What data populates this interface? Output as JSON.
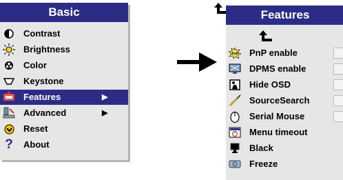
{
  "basic_menu": {
    "title": "Basic",
    "items": [
      {
        "label": "Contrast",
        "icon": "contrast-icon",
        "has_submenu": false,
        "selected": false
      },
      {
        "label": "Brightness",
        "icon": "brightness-icon",
        "has_submenu": false,
        "selected": false
      },
      {
        "label": "Color",
        "icon": "color-icon",
        "has_submenu": false,
        "selected": false
      },
      {
        "label": "Keystone",
        "icon": "keystone-icon",
        "has_submenu": false,
        "selected": false
      },
      {
        "label": "Features",
        "icon": "features-icon",
        "has_submenu": true,
        "selected": true
      },
      {
        "label": "Advanced",
        "icon": "advanced-icon",
        "has_submenu": true,
        "selected": false
      },
      {
        "label": "Reset",
        "icon": "reset-icon",
        "has_submenu": false,
        "selected": false
      },
      {
        "label": "About",
        "icon": "about-icon",
        "has_submenu": false,
        "selected": false
      }
    ]
  },
  "features_menu": {
    "title": "Features",
    "items": [
      {
        "label": "PnP enable",
        "icon": "pnp-icon",
        "has_checkbox": true
      },
      {
        "label": "DPMS enable",
        "icon": "dpms-icon",
        "has_checkbox": true
      },
      {
        "label": "Hide OSD",
        "icon": "hide-osd-icon",
        "has_checkbox": true
      },
      {
        "label": "SourceSearch",
        "icon": "source-search-icon",
        "has_checkbox": true
      },
      {
        "label": "Serial Mouse",
        "icon": "mouse-icon",
        "has_checkbox": true
      },
      {
        "label": "Menu timeout",
        "icon": "menu-timeout-icon",
        "has_checkbox": false
      },
      {
        "label": "Black",
        "icon": "black-icon",
        "has_checkbox": false
      },
      {
        "label": "Freeze",
        "icon": "freeze-icon",
        "has_checkbox": false
      }
    ]
  },
  "colors": {
    "title_bar": "#2c2c86",
    "selected_row": "#2c2c86",
    "panel": "#e6e6e6"
  }
}
